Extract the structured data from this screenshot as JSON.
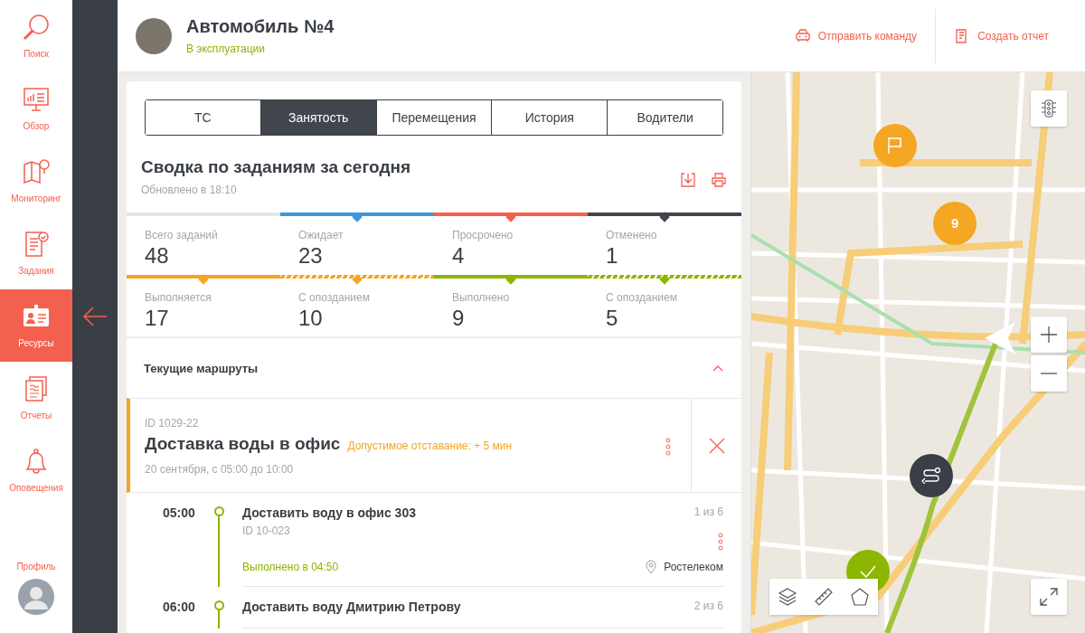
{
  "nav": {
    "items": [
      {
        "label": "Поиск",
        "kind": "search",
        "selected": false
      },
      {
        "label": "Обзор",
        "kind": "overview",
        "selected": false
      },
      {
        "label": "Мониторинг",
        "kind": "monitoring",
        "selected": false
      },
      {
        "label": "Задания",
        "kind": "tasks",
        "selected": false
      },
      {
        "label": "Ресурсы",
        "kind": "resources",
        "selected": true
      },
      {
        "label": "Отчеты",
        "kind": "reports",
        "selected": false
      },
      {
        "label": "Оповещения",
        "kind": "alerts",
        "selected": false
      }
    ],
    "profile": {
      "label": "Профиль"
    }
  },
  "header": {
    "title": "Автомобиль №4",
    "status": "В эксплуатации",
    "actions": [
      {
        "label": "Отправить команду",
        "kind": "command"
      },
      {
        "label": "Создать отчет",
        "kind": "report"
      }
    ]
  },
  "tabs": [
    {
      "label": "ТС",
      "selected": false
    },
    {
      "label": "Занятость",
      "selected": true
    },
    {
      "label": "Перемещения",
      "selected": false
    },
    {
      "label": "История",
      "selected": false
    },
    {
      "label": "Водители",
      "selected": false
    }
  ],
  "summary": {
    "title": "Сводка по заданиям за сегодня",
    "updated": "Обновлено в 18:10"
  },
  "stats": [
    [
      {
        "label": "Всего заданий",
        "value": "48",
        "color": "#e6e6e6",
        "kind": "solid"
      },
      {
        "label": "Ожидает",
        "value": "23",
        "color": "#3a9ad9",
        "kind": "solid"
      },
      {
        "label": "Просрочено",
        "value": "4",
        "color": "#f4604f",
        "kind": "solid"
      },
      {
        "label": "Отменено",
        "value": "1",
        "color": "#41464d",
        "kind": "solid"
      }
    ],
    [
      {
        "label": "Выполняется",
        "value": "17",
        "color": "#f5a623",
        "kind": "solid"
      },
      {
        "label": "С опозданием",
        "value": "10",
        "color": "#f5a623",
        "kind": "hatched"
      },
      {
        "label": "Выполнено",
        "value": "9",
        "color": "#8db600",
        "kind": "solid"
      },
      {
        "label": "С опозданием",
        "value": "5",
        "color": "#8db600",
        "kind": "hatched"
      }
    ]
  ],
  "routes": {
    "title": "Текущие маршруты",
    "expanded": true,
    "route": {
      "id": "ID 1029-22",
      "title": "Доставка воды в офис",
      "tolerance": "Допустимое отставание: + 5 мин",
      "period": "20 сентября, с 05:00 до 10:00",
      "stops": [
        {
          "time": "05:00",
          "title": "Доставить воду в офис 303",
          "id": "ID 10-023",
          "counter": "1 из 6",
          "status": "Выполнено в 04:50",
          "location": "Ростелеком"
        },
        {
          "time": "06:00",
          "title": "Доставить воду Дмитрию Петрову",
          "counter": "2 из 6"
        }
      ]
    }
  },
  "map": {
    "markers": [
      {
        "kind": "flag"
      },
      {
        "kind": "cluster",
        "label": "9"
      },
      {
        "kind": "route"
      },
      {
        "kind": "done"
      }
    ]
  }
}
